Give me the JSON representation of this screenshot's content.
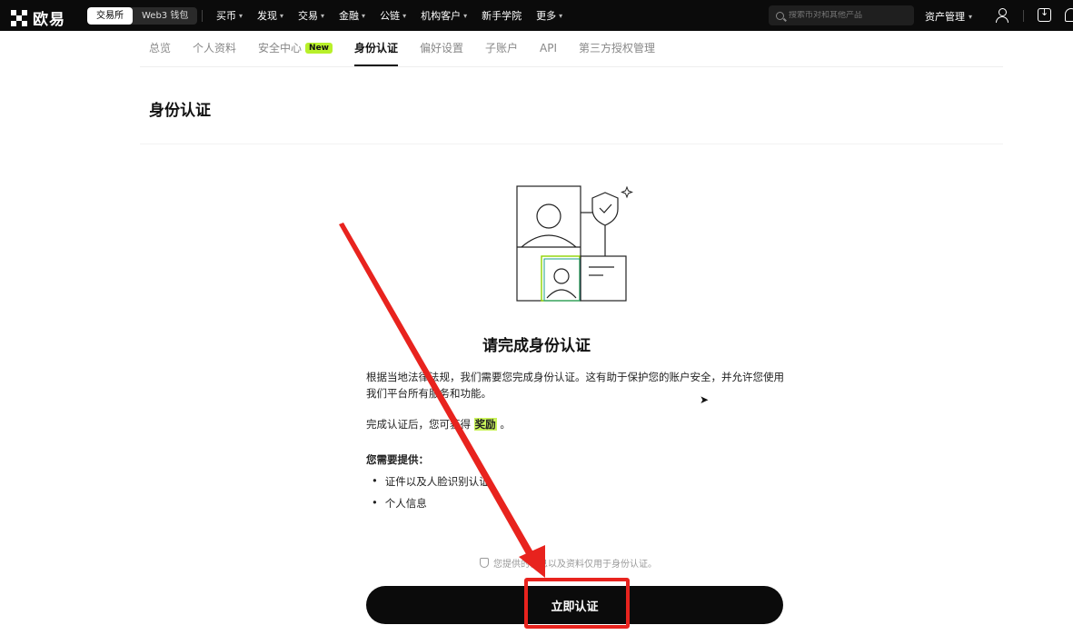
{
  "topbar": {
    "logo_text": "欧易",
    "switch": [
      "交易所",
      "Web3 钱包"
    ],
    "nav": [
      "买币",
      "发现",
      "交易",
      "金融",
      "公链",
      "机构客户",
      "新手学院",
      "更多"
    ],
    "nav_caret": [
      true,
      true,
      true,
      true,
      true,
      true,
      false,
      true
    ],
    "search_placeholder": "搜索币对和其他产品",
    "assets_label": "资产管理"
  },
  "tabs": [
    {
      "label": "总览",
      "active": false
    },
    {
      "label": "个人资料",
      "active": false
    },
    {
      "label": "安全中心",
      "active": false,
      "badge": "New"
    },
    {
      "label": "身份认证",
      "active": true
    },
    {
      "label": "偏好设置",
      "active": false
    },
    {
      "label": "子账户",
      "active": false
    },
    {
      "label": "API",
      "active": false
    },
    {
      "label": "第三方授权管理",
      "active": false
    }
  ],
  "page_title": "身份认证",
  "card": {
    "title": "请完成身份认证",
    "description": "根据当地法律法规，我们需要您完成身份认证。这有助于保护您的账户安全，并允许您使用我们平台所有服务和功能。",
    "reward_prefix": "完成认证后，您可获得",
    "reward_word": "奖励",
    "reward_suffix": "。",
    "need_title": "您需要提供：",
    "need_items": [
      "证件以及人脸识别认证",
      "个人信息"
    ],
    "privacy_note": "您提供的信息以及资料仅用于身份认证。",
    "cta_label": "立即认证"
  },
  "colors": {
    "accent_green": "#b8f02a",
    "annotation_red": "#e8231e"
  }
}
